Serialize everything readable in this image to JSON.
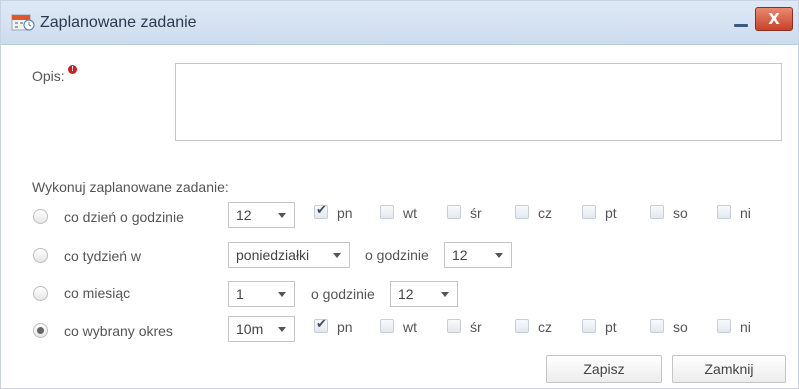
{
  "window": {
    "title": "Zaplanowane zadanie",
    "close_glyph": "X"
  },
  "form": {
    "opis_label": "Opis:",
    "required_mark": "!",
    "opis_value": "",
    "section_title": "Wykonuj zaplanowane zadanie:",
    "o_godzinie_label": "o godzinie"
  },
  "options": [
    {
      "label": "co dzień o godzinie",
      "selected": false,
      "hour": "12",
      "days": [
        {
          "label": "pn",
          "checked": true
        },
        {
          "label": "wt",
          "checked": false
        },
        {
          "label": "śr",
          "checked": false
        },
        {
          "label": "cz",
          "checked": false
        },
        {
          "label": "pt",
          "checked": false
        },
        {
          "label": "so",
          "checked": false
        },
        {
          "label": "ni",
          "checked": false
        }
      ]
    },
    {
      "label": "co tydzień w",
      "selected": false,
      "weekday": "poniedziałki",
      "hour": "12"
    },
    {
      "label": "co miesiąc",
      "selected": false,
      "day_of_month": "1",
      "hour": "12"
    },
    {
      "label": "co wybrany okres",
      "selected": true,
      "period": "10m",
      "days": [
        {
          "label": "pn",
          "checked": true
        },
        {
          "label": "wt",
          "checked": false
        },
        {
          "label": "śr",
          "checked": false
        },
        {
          "label": "cz",
          "checked": false
        },
        {
          "label": "pt",
          "checked": false
        },
        {
          "label": "so",
          "checked": false
        },
        {
          "label": "ni",
          "checked": false
        }
      ]
    }
  ],
  "buttons": {
    "save": "Zapisz",
    "close": "Zamknij"
  },
  "colors": {
    "titlebar": "#ccdcee",
    "close_button": "#c8412a",
    "required": "#cc1f1f"
  }
}
